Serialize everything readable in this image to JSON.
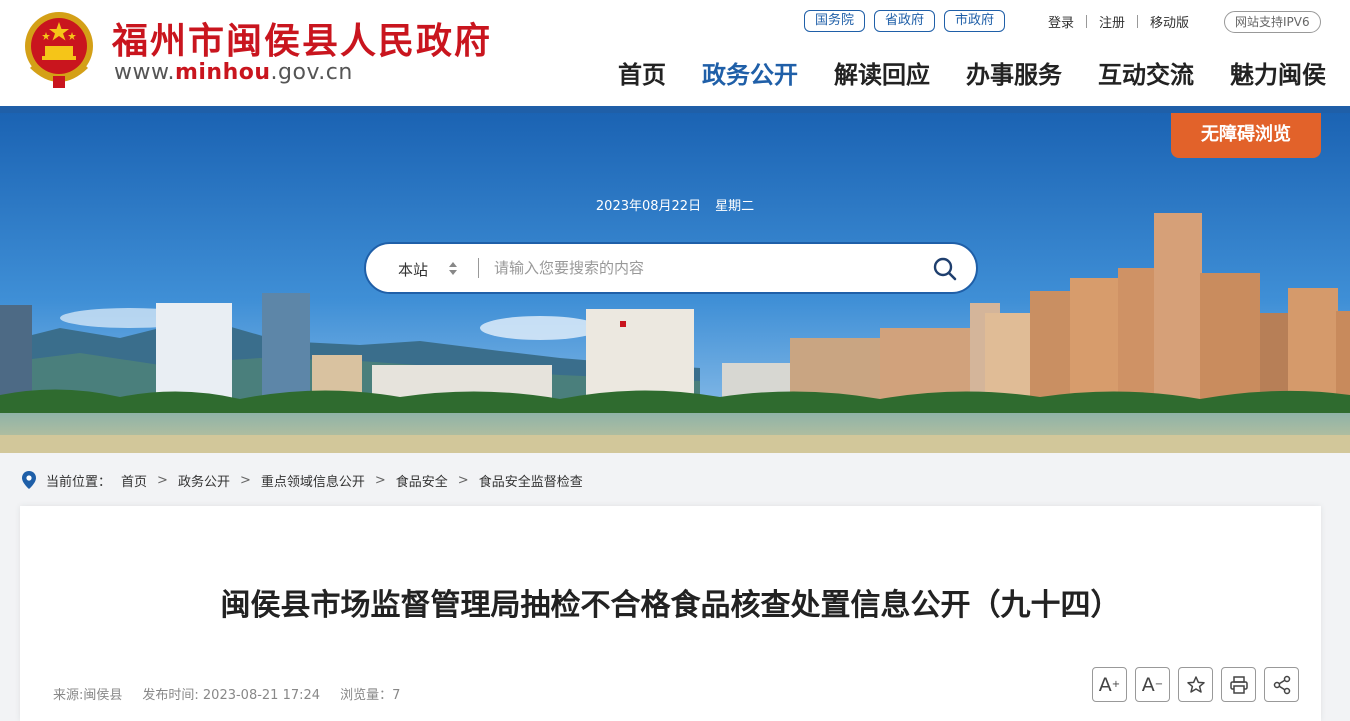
{
  "header": {
    "site_name": "福州市闽侯县人民政府",
    "url_prefix": "www.",
    "url_highlight": "minhou",
    "url_suffix": ".gov.cn",
    "quick_links": [
      "国务院",
      "省政府",
      "市政府"
    ],
    "user_links": [
      "登录",
      "注册",
      "移动版"
    ],
    "ipv6_badge": "网站支持IPV6",
    "nav": [
      "首页",
      "政务公开",
      "解读回应",
      "办事服务",
      "互动交流",
      "魅力闽侯"
    ],
    "active_nav": "政务公开"
  },
  "banner": {
    "accessibility_button": "无障碍浏览",
    "date": "2023年08月22日",
    "weekday": "星期二"
  },
  "search": {
    "scope": "本站",
    "placeholder": "请输入您要搜索的内容",
    "value": ""
  },
  "breadcrumb": {
    "prefix": "当前位置：",
    "items": [
      "首页",
      "政务公开",
      "重点领域信息公开",
      "食品安全",
      "食品安全监督检查"
    ]
  },
  "article": {
    "title": "闽侯县市场监督管理局抽检不合格食品核查处置信息公开（九十四）",
    "source": "来源:闽侯县",
    "published": "发布时间: 2023-08-21 17:24",
    "views": "浏览量：7",
    "tools": {
      "font_increase": "A",
      "font_decrease": "A",
      "plus_sign": "+",
      "minus_sign": "−"
    }
  },
  "colors": {
    "brand_red": "#c9151e",
    "brand_blue": "#1f5fa8",
    "accent_orange": "#e2622a"
  }
}
